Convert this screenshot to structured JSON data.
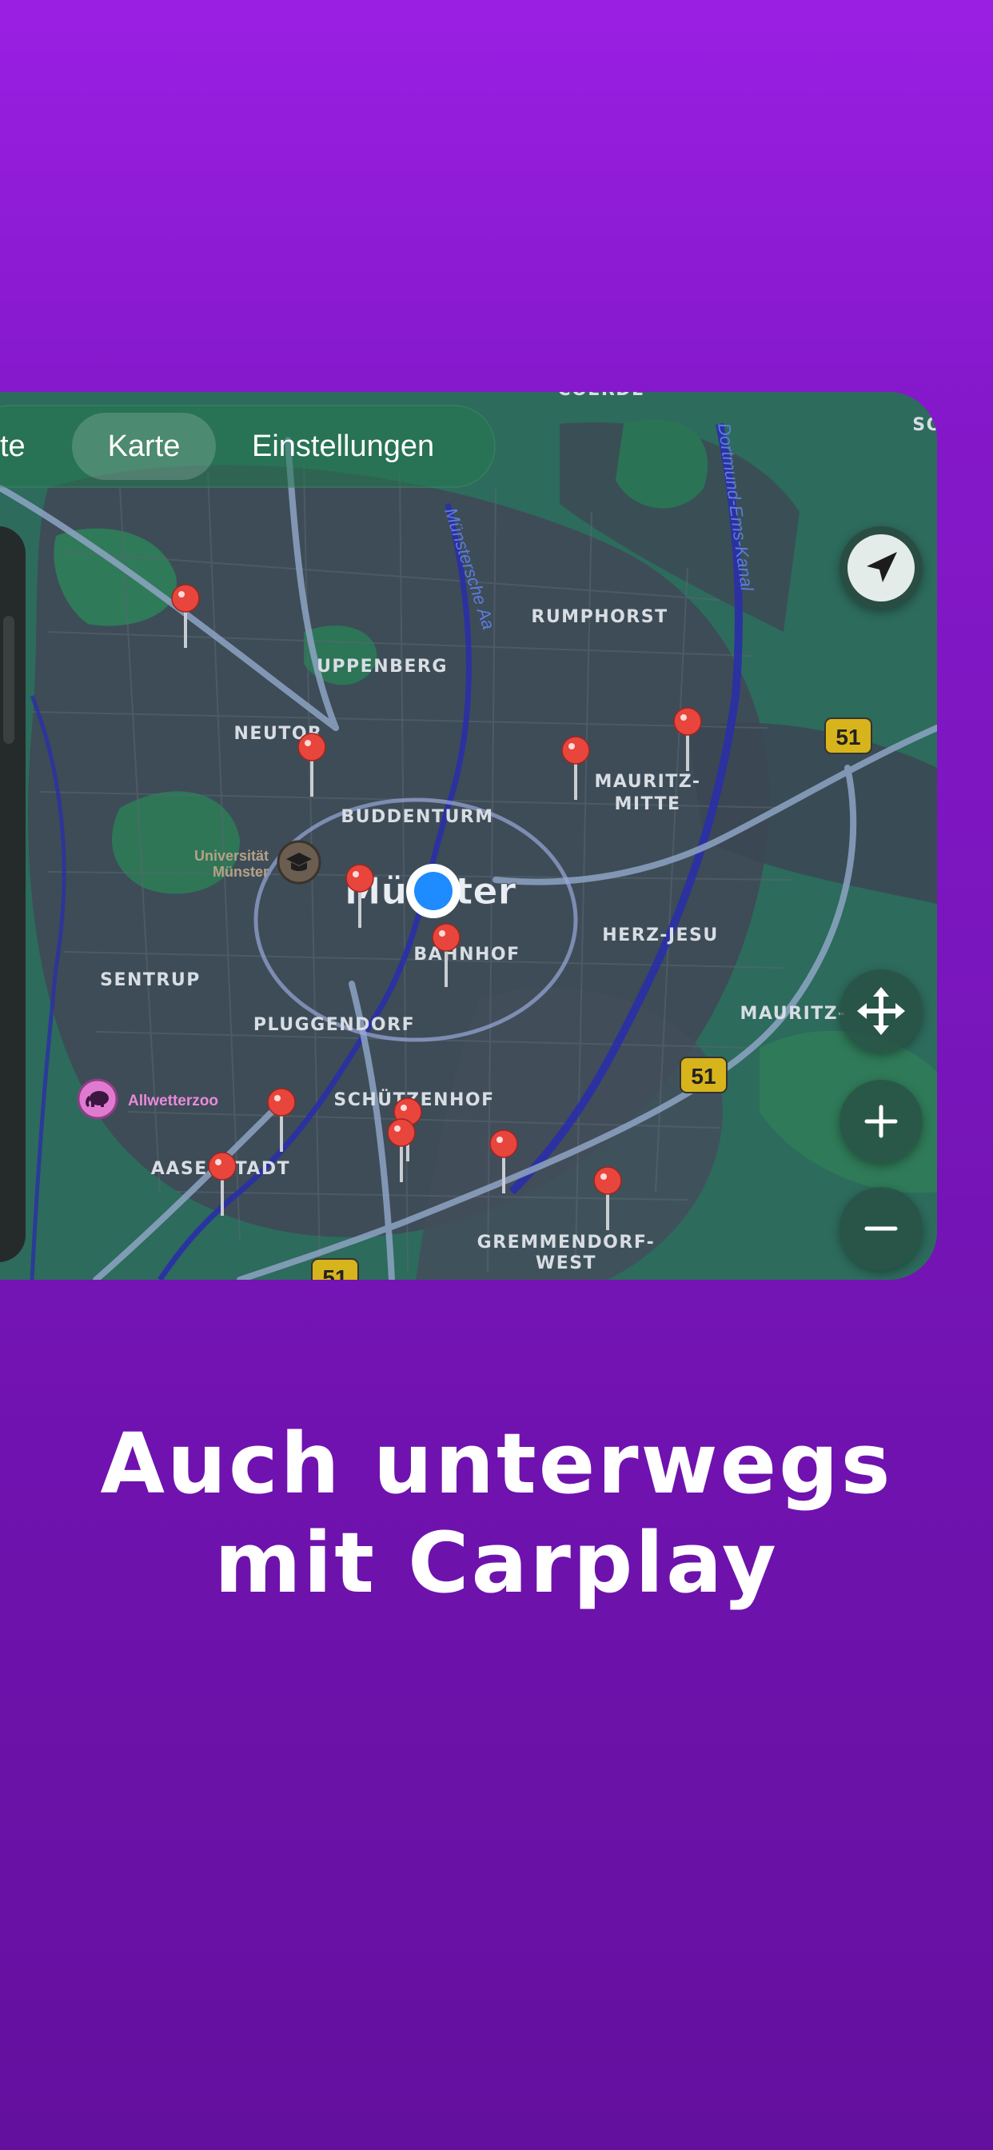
{
  "tabs": [
    {
      "label": "te"
    },
    {
      "label": "Karte",
      "selected": true
    },
    {
      "label": "Einstellungen"
    }
  ],
  "map": {
    "city_label": "Münster",
    "districts": [
      "COERDE",
      "RUMPHORST",
      "UPPENBERG",
      "NEUTOR",
      "BUDDENTURM",
      "MAURITZ-",
      "MITTE",
      "HERZ-JESU",
      "BAHNHOF",
      "SENTRUP",
      "PLUGGENDORF",
      "SCHÜTZENHOF",
      "AASEESTADT",
      "GREMMENDORF-",
      "WEST",
      "MAURITZ-",
      "SO"
    ],
    "pois": [
      {
        "label": "Universität",
        "label2": "Münster",
        "icon": "graduation-cap-icon"
      },
      {
        "label": "Allwetterzoo",
        "icon": "elephant-icon"
      }
    ],
    "road_shields": [
      "51",
      "51",
      "51"
    ],
    "waterways": [
      "Münstersche Aa",
      "Dortmund-Ems-Kanal"
    ],
    "pin_count": 13
  },
  "controls": {
    "locate": "location-arrow-icon",
    "pan": "move-arrows-icon",
    "zoom_in": "plus-icon",
    "zoom_out": "minus-icon"
  },
  "headline": {
    "line1": "Auch unterwegs",
    "line2": "mit Carplay"
  },
  "colors": {
    "background": "#8a1ad0",
    "pin": "#e8453c",
    "user_location": "#1e8bff",
    "shield": "#d8b41c"
  }
}
